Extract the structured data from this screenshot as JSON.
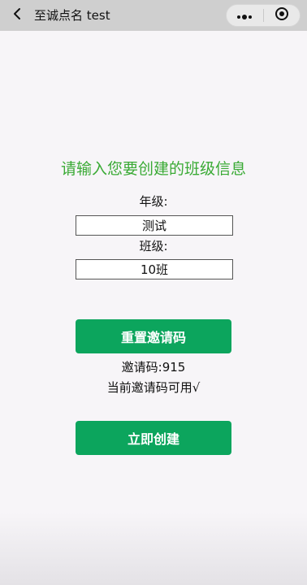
{
  "navbar": {
    "title": "至诚点名 test",
    "back_icon": "chevron-left-icon",
    "menu_icon": "more-dots-icon",
    "close_icon": "target-circle-icon"
  },
  "form": {
    "heading": "请输入您要创建的班级信息",
    "grade_label": "年级:",
    "grade_value": "测试",
    "class_label": "班级:",
    "class_value": "10班"
  },
  "invite": {
    "reset_button": "重置邀请码",
    "code_text": "邀请码:915",
    "status_text": "当前邀请码可用√"
  },
  "actions": {
    "create_button": "立即创建"
  },
  "colors": {
    "heading": "#3aaa35",
    "button": "#0ca55d",
    "navbar": "#cfcfcf",
    "background": "#f7f5f8"
  }
}
